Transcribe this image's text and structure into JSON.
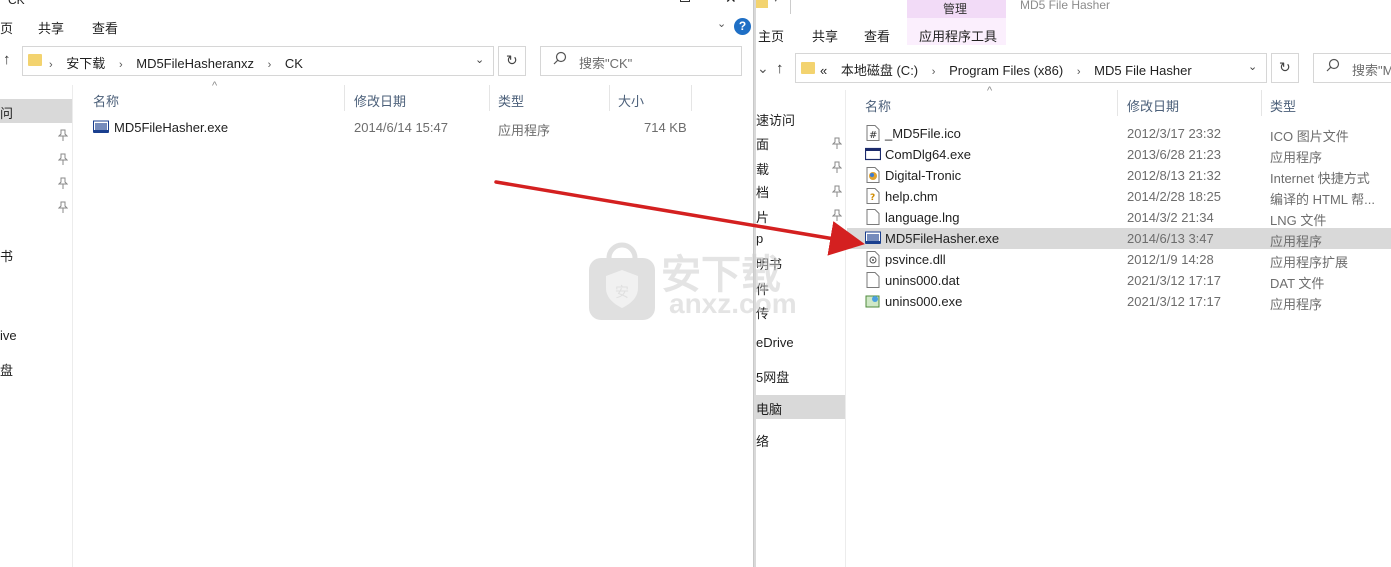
{
  "left_window": {
    "title": "CK",
    "ribbon_tabs": [
      "页",
      "共享",
      "查看"
    ],
    "breadcrumb": [
      "安下载",
      "MD5FileHasheranxz",
      "CK"
    ],
    "search_placeholder": "搜索\"CK\"",
    "nav_items": [
      "问",
      "书",
      "ive",
      "盘"
    ],
    "columns": [
      "名称",
      "修改日期",
      "类型",
      "大小"
    ],
    "files": [
      {
        "name": "MD5FileHasher.exe",
        "date": "2014/6/14 15:47",
        "type": "应用程序",
        "size": "714 KB",
        "icon": "md5-app-icon"
      }
    ]
  },
  "right_window": {
    "title": "MD5 File Hasher",
    "context_tab_group": "管理",
    "ribbon_tabs": [
      "主页",
      "共享",
      "查看",
      "应用程序工具"
    ],
    "breadcrumb": [
      "«",
      "本地磁盘 (C:)",
      "Program Files (x86)",
      "MD5 File Hasher"
    ],
    "search_placeholder": "搜索\"M",
    "nav_items": [
      "速访问",
      "面",
      "载",
      "档",
      "片",
      "p",
      "明书",
      "件",
      "传",
      "eDrive",
      "5网盘",
      "电脑",
      "络"
    ],
    "columns": [
      "名称",
      "修改日期",
      "类型"
    ],
    "files": [
      {
        "name": "_MD5File.ico",
        "date": "2012/3/17 23:32",
        "type": "ICO 图片文件",
        "icon": "ico-file-icon"
      },
      {
        "name": "ComDlg64.exe",
        "date": "2013/6/28 21:23",
        "type": "应用程序",
        "icon": "window-app-icon"
      },
      {
        "name": "Digital-Tronic",
        "date": "2012/8/13 21:32",
        "type": "Internet 快捷方式",
        "icon": "internet-shortcut-icon"
      },
      {
        "name": "help.chm",
        "date": "2014/2/28 18:25",
        "type": "编译的 HTML 帮...",
        "icon": "chm-help-icon"
      },
      {
        "name": "language.lng",
        "date": "2014/3/2 21:34",
        "type": "LNG 文件",
        "icon": "blank-file-icon"
      },
      {
        "name": "MD5FileHasher.exe",
        "date": "2014/6/13 3:47",
        "type": "应用程序",
        "icon": "md5-app-icon"
      },
      {
        "name": "psvince.dll",
        "date": "2012/1/9 14:28",
        "type": "应用程序扩展",
        "icon": "dll-file-icon"
      },
      {
        "name": "unins000.dat",
        "date": "2021/3/12 17:17",
        "type": "DAT 文件",
        "icon": "blank-file-icon"
      },
      {
        "name": "unins000.exe",
        "date": "2021/3/12 17:17",
        "type": "应用程序",
        "icon": "installer-icon"
      }
    ],
    "selected_index": 5
  },
  "watermark": {
    "cn": "安下载",
    "en": "anxz.com"
  },
  "colors": {
    "arrow": "#d42020",
    "selection": "#d9d9d9",
    "header_text": "#4c607a",
    "context_tab": "#f2dbf7"
  }
}
